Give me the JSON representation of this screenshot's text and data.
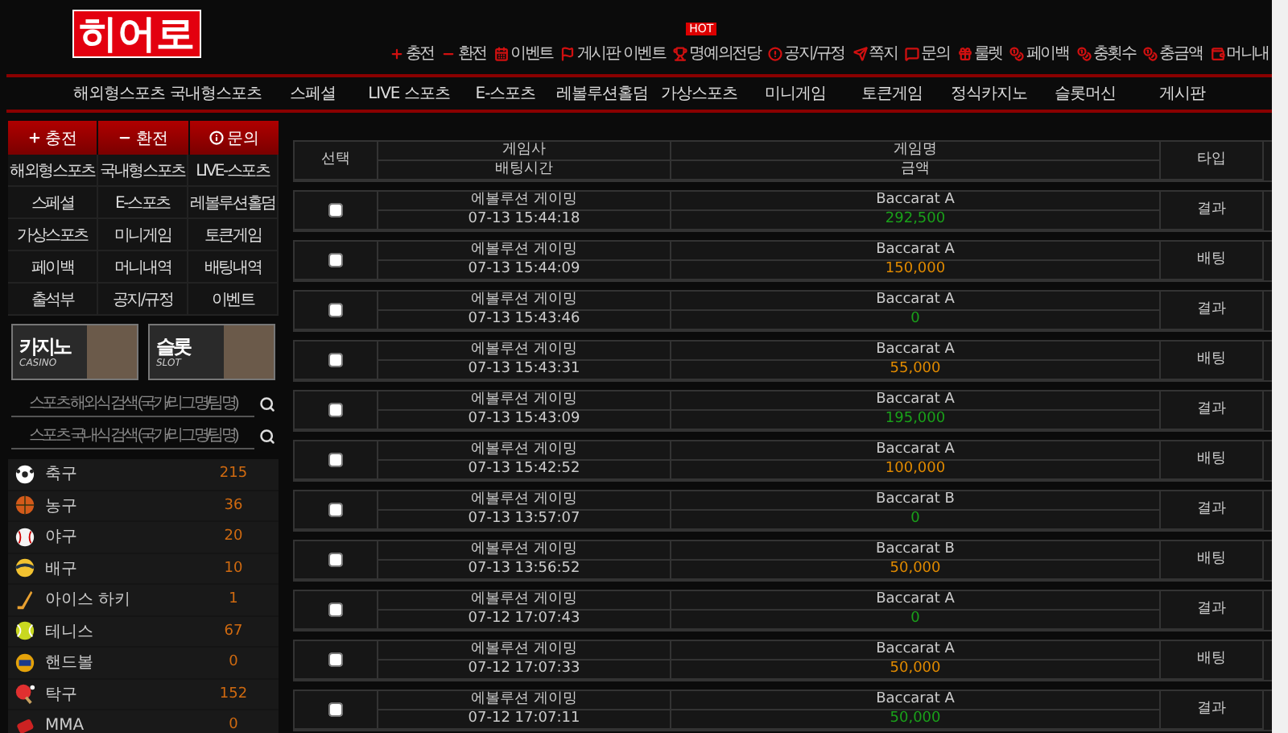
{
  "logo": "히어로",
  "top_links": [
    {
      "label": "충전"
    },
    {
      "label": "환전"
    },
    {
      "label": "이벤트"
    },
    {
      "label": "게시판 이벤트"
    },
    {
      "label": "명예의전당",
      "badge": "HOT"
    },
    {
      "label": "공지/규정"
    },
    {
      "label": "쪽지"
    },
    {
      "label": "문의"
    },
    {
      "label": "룰렛"
    },
    {
      "label": "페이백"
    },
    {
      "label": "충횟수"
    },
    {
      "label": "충금액"
    },
    {
      "label": "머니내"
    }
  ],
  "nav": [
    "해외형스포츠",
    "국내형스포츠",
    "스페셜",
    "LIVE 스포츠",
    "E-스포츠",
    "레볼루션홀덤",
    "가상스포츠",
    "미니게임",
    "토큰게임",
    "정식카지노",
    "슬롯머신",
    "게시판"
  ],
  "sidebar": {
    "actions": [
      "충전",
      "환전",
      "문의"
    ],
    "menu": [
      "해외형스포츠",
      "국내형스포츠",
      "LIVE-스포츠",
      "스페셜",
      "E-스포츠",
      "레볼루션홀덤",
      "가상스포츠",
      "미니게임",
      "토큰게임",
      "페이백",
      "머니내역",
      "배팅내역",
      "출석부",
      "공지/규정",
      "이벤트"
    ],
    "banners": [
      {
        "title": "카지노",
        "subtitle": "CASINO"
      },
      {
        "title": "슬롯",
        "subtitle": "SLOT"
      }
    ],
    "searches": [
      {
        "placeholder": "스포츠 해외식 검색 (국가/리그명/팀명)"
      },
      {
        "placeholder": "스포츠 국내식 검색 (국가/리그명/팀명)"
      }
    ],
    "sports": [
      {
        "kind": "soccer",
        "name": "축구",
        "count": "215"
      },
      {
        "kind": "basketball",
        "name": "농구",
        "count": "36"
      },
      {
        "kind": "baseball",
        "name": "야구",
        "count": "20"
      },
      {
        "kind": "volleyball",
        "name": "배구",
        "count": "10"
      },
      {
        "kind": "hockey",
        "name": "아이스 하키",
        "count": "1"
      },
      {
        "kind": "tennis",
        "name": "테니스",
        "count": "67"
      },
      {
        "kind": "handball",
        "name": "핸드볼",
        "count": "0"
      },
      {
        "kind": "tabletennis",
        "name": "탁구",
        "count": "152"
      },
      {
        "kind": "mma",
        "name": "MMA",
        "count": "0"
      }
    ]
  },
  "table": {
    "columns": {
      "select": "선택",
      "provider": "게임사",
      "time": "배팅시간",
      "game": "게임명",
      "amount": "금액",
      "type": "타입"
    },
    "rows": [
      {
        "checked": false,
        "provider": "에볼루션 게이밍",
        "time": "07-13 15:44:18",
        "game": "Baccarat A",
        "amount": "292,500",
        "kind": "result",
        "type": "결과"
      },
      {
        "checked": false,
        "provider": "에볼루션 게이밍",
        "time": "07-13 15:44:09",
        "game": "Baccarat A",
        "amount": "150,000",
        "kind": "bet",
        "type": "배팅"
      },
      {
        "checked": false,
        "provider": "에볼루션 게이밍",
        "time": "07-13 15:43:46",
        "game": "Baccarat A",
        "amount": "0",
        "kind": "result",
        "type": "결과"
      },
      {
        "checked": false,
        "provider": "에볼루션 게이밍",
        "time": "07-13 15:43:31",
        "game": "Baccarat A",
        "amount": "55,000",
        "kind": "bet",
        "type": "배팅"
      },
      {
        "checked": false,
        "provider": "에볼루션 게이밍",
        "time": "07-13 15:43:09",
        "game": "Baccarat A",
        "amount": "195,000",
        "kind": "result",
        "type": "결과"
      },
      {
        "checked": false,
        "provider": "에볼루션 게이밍",
        "time": "07-13 15:42:52",
        "game": "Baccarat A",
        "amount": "100,000",
        "kind": "bet",
        "type": "배팅"
      },
      {
        "checked": false,
        "provider": "에볼루션 게이밍",
        "time": "07-13 13:57:07",
        "game": "Baccarat B",
        "amount": "0",
        "kind": "result",
        "type": "결과"
      },
      {
        "checked": false,
        "provider": "에볼루션 게이밍",
        "time": "07-13 13:56:52",
        "game": "Baccarat B",
        "amount": "50,000",
        "kind": "bet",
        "type": "배팅"
      },
      {
        "checked": false,
        "provider": "에볼루션 게이밍",
        "time": "07-12 17:07:43",
        "game": "Baccarat A",
        "amount": "0",
        "kind": "result",
        "type": "결과"
      },
      {
        "checked": false,
        "provider": "에볼루션 게이밍",
        "time": "07-12 17:07:33",
        "game": "Baccarat A",
        "amount": "50,000",
        "kind": "bet",
        "type": "배팅"
      },
      {
        "checked": false,
        "provider": "에볼루션 게이밍",
        "time": "07-12 17:07:11",
        "game": "Baccarat A",
        "amount": "50,000",
        "kind": "result",
        "type": "결과"
      }
    ]
  }
}
